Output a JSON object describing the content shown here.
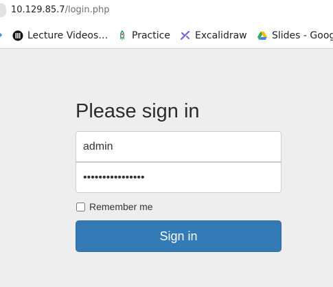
{
  "browser": {
    "url_host": "10.129.85.7",
    "url_path": "/login.php"
  },
  "bookmarks": [
    {
      "label": "Lecture Videos…",
      "icon": "lecture-videos-icon"
    },
    {
      "label": "Practice",
      "icon": "rocket-icon"
    },
    {
      "label": "Excalidraw",
      "icon": "excalidraw-icon"
    },
    {
      "label": "Slides - Goog",
      "icon": "google-drive-icon"
    }
  ],
  "login": {
    "heading": "Please sign in",
    "username_value": "admin",
    "password_value": "••••••••••••••••",
    "remember_label": "Remember me",
    "remember_checked": false,
    "submit_label": "Sign in"
  },
  "colors": {
    "page_bg": "#eeeeee",
    "button_bg": "#337ab7",
    "button_border": "#2e6da4"
  }
}
